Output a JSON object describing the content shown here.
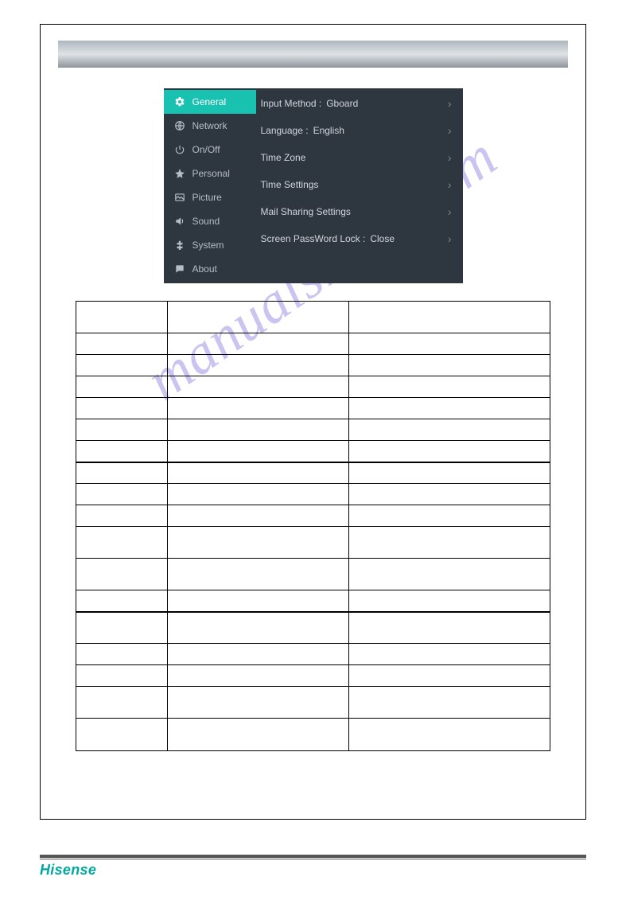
{
  "brand": "Hisense",
  "watermark": "manualshive.com",
  "sidebar": {
    "items": [
      {
        "label": "General",
        "icon": "gear-icon",
        "active": true
      },
      {
        "label": "Network",
        "icon": "globe-icon",
        "active": false
      },
      {
        "label": "On/Off",
        "icon": "power-icon",
        "active": false
      },
      {
        "label": "Personal",
        "icon": "star-icon",
        "active": false
      },
      {
        "label": "Picture",
        "icon": "image-icon",
        "active": false
      },
      {
        "label": "Sound",
        "icon": "speaker-icon",
        "active": false
      },
      {
        "label": "System",
        "icon": "puzzle-icon",
        "active": false
      },
      {
        "label": "About",
        "icon": "chat-icon",
        "active": false
      }
    ]
  },
  "settings": {
    "rows": [
      {
        "label": "Input Method :",
        "value": "Gboard"
      },
      {
        "label": "Language :",
        "value": "English"
      },
      {
        "label": "Time Zone",
        "value": ""
      },
      {
        "label": "Time Settings",
        "value": ""
      },
      {
        "label": "Mail Sharing Settings",
        "value": ""
      },
      {
        "label": "Screen PassWord Lock :",
        "value": "Close"
      }
    ]
  },
  "colors": {
    "accent": "#18c1b0",
    "panel": "#2e3640",
    "brand": "#00a8a0"
  }
}
